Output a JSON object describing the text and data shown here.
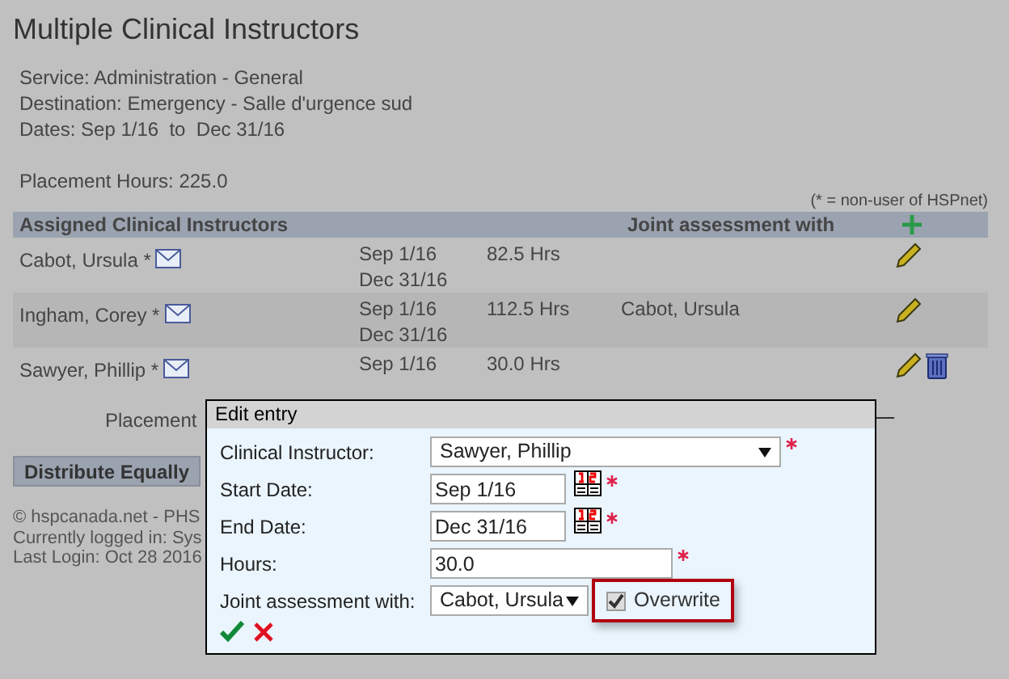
{
  "title": "Multiple Clinical Instructors",
  "info_lines": [
    "Service: Administration - General",
    "Destination: Emergency - Salle d'urgence sud",
    "Dates: Sep 1/16  to  Dec 31/16"
  ],
  "placement_hours": "Placement Hours: 225.0",
  "legend_note": "(* = non-user of HSPnet)",
  "table": {
    "columns": [
      "Assigned Clinical Instructors",
      "Joint assessment with"
    ],
    "rows": [
      {
        "name": "Cabot, Ursula *",
        "start": "Sep 1/16",
        "end": "Dec 31/16",
        "hours": "82.5 Hrs",
        "joint": "",
        "deletable": false
      },
      {
        "name": "Ingham, Corey *",
        "start": "Sep 1/16",
        "end": "Dec 31/16",
        "hours": "112.5 Hrs",
        "joint": "Cabot, Ursula",
        "deletable": false
      },
      {
        "name": "Sawyer, Phillip *",
        "start": "Sep 1/16",
        "end": "",
        "hours": "30.0 Hrs",
        "joint": "",
        "deletable": true
      }
    ]
  },
  "placement_partial": "Placement",
  "distribute_button": "Distribute Equally",
  "footer": [
    "© hspcanada.net - PHS",
    "Currently logged in: Sys",
    "Last Login: Oct 28 2016"
  ],
  "dialog": {
    "title": "Edit entry",
    "fields": [
      {
        "kind": "select",
        "label": "Clinical Instructor:",
        "value": "Sawyer, Phillip",
        "required": true
      },
      {
        "kind": "date",
        "label": "Start Date:",
        "value": "Sep 1/16",
        "required": true
      },
      {
        "kind": "date",
        "label": "End Date:",
        "value": "Dec 31/16",
        "required": true
      },
      {
        "kind": "text",
        "label": "Hours:",
        "value": "30.0",
        "required": true
      },
      {
        "kind": "select_small",
        "label": "Joint assessment with:",
        "value": "Cabot, Ursula",
        "required": false
      }
    ],
    "overwrite": {
      "label": "Overwrite",
      "checked": true
    }
  }
}
